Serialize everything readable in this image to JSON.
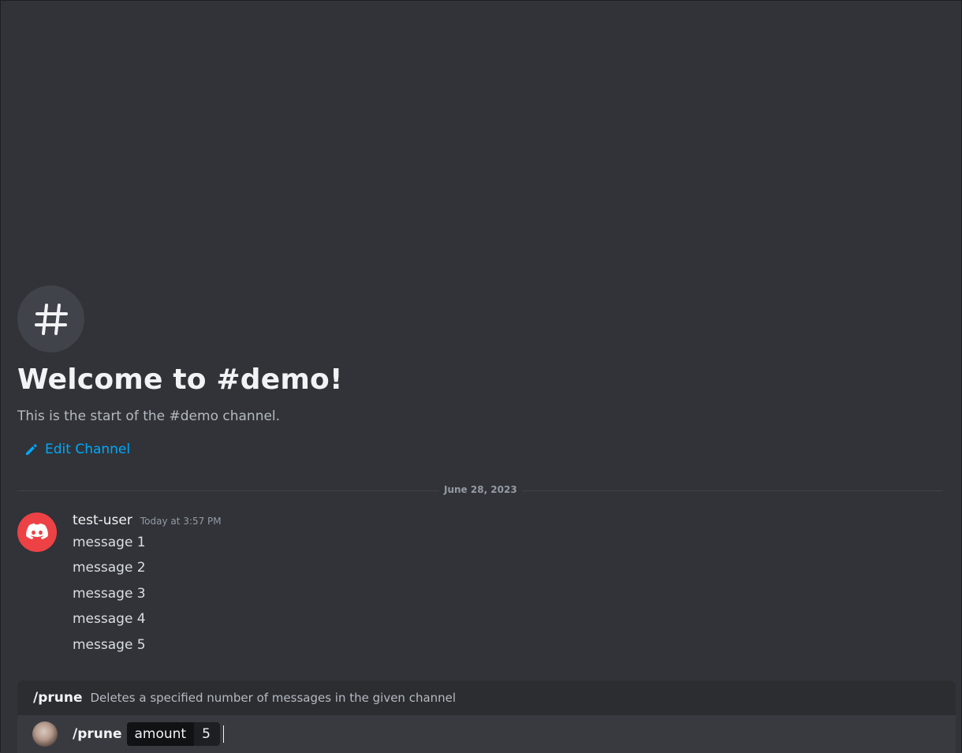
{
  "channel": {
    "welcome_title": "Welcome to #demo!",
    "welcome_subtitle": "This is the start of the #demo channel.",
    "edit_label": "Edit Channel",
    "icon": "hash-icon"
  },
  "divider": {
    "date": "June 28, 2023"
  },
  "message_group": {
    "username": "test-user",
    "timestamp": "Today at 3:57 PM",
    "avatar_icon": "discord-logo-icon",
    "avatar_color": "#ed4245",
    "messages": [
      "message 1",
      "message 2",
      "message 3",
      "message 4",
      "message 5"
    ]
  },
  "command_popup": {
    "name": "/prune",
    "description": "Deletes a specified number of messages in the given channel"
  },
  "command_input": {
    "command": "/prune",
    "param_name": "amount",
    "param_value": "5"
  },
  "colors": {
    "background": "#313338",
    "link": "#00a8fc"
  }
}
